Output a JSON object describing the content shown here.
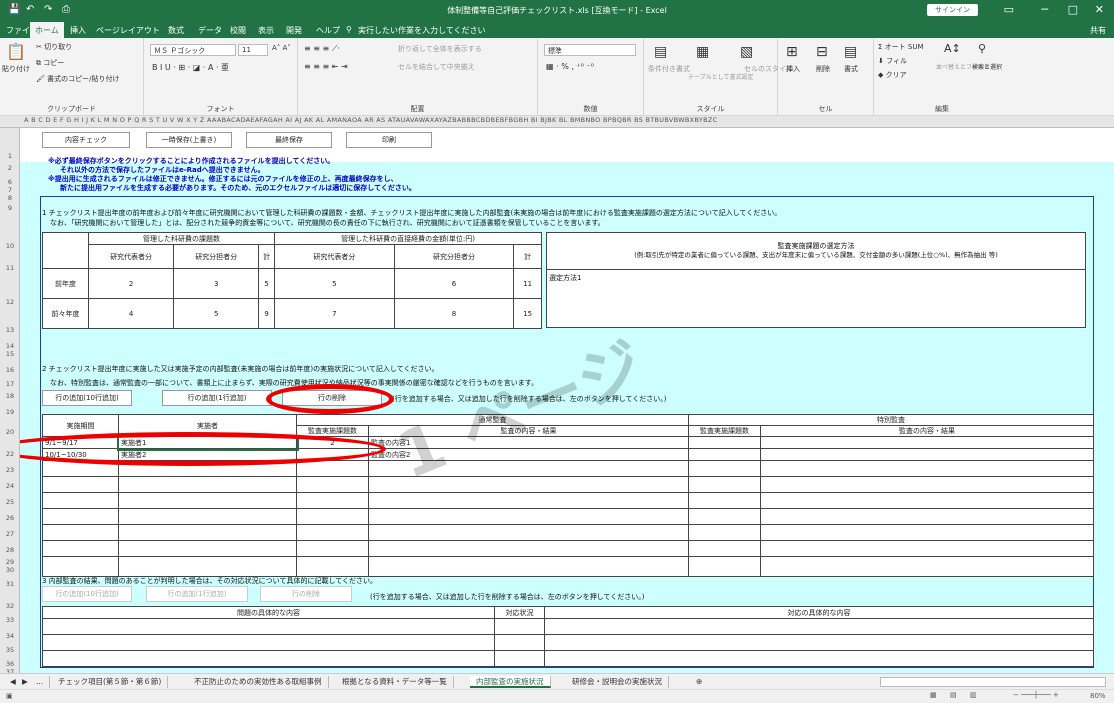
{
  "title": "体制整備等自己評価チェックリスト.xls [互換モード] - Excel",
  "signin": "サインイン",
  "ribbon_tabs": [
    "ファイル",
    "ホーム",
    "挿入",
    "ページレイアウト",
    "数式",
    "データ",
    "校閲",
    "表示",
    "開発",
    "ヘルプ"
  ],
  "tell_me": "実行したい作業を入力してください",
  "share": "共有",
  "clipboard": {
    "paste": "貼り付け",
    "cut": "切り取り",
    "copy": "コピー",
    "format_painter": "書式のコピー/貼り付け",
    "label": "クリップボード"
  },
  "font": {
    "name": "ＭＳ Ｐゴシック",
    "size": "11",
    "label": "フォント"
  },
  "align": {
    "wrap": "折り返して全体を表示する",
    "merge": "セルを結合して中央揃え",
    "label": "配置"
  },
  "number": {
    "format": "標準",
    "label": "数値"
  },
  "styles": {
    "cond": "条件付き書式",
    "table": "テーブルとして書式設定",
    "cell": "セルのスタイル",
    "label": "スタイル"
  },
  "cells": {
    "insert": "挿入",
    "delete": "削除",
    "format": "書式",
    "label": "セル"
  },
  "editing": {
    "autosum": "オート SUM",
    "fill": "フィル",
    "clear": "クリア",
    "sort": "並べ替えとフィルター",
    "find": "検索と選択",
    "label": "編集"
  },
  "col_headers": "A  B  C  D  E  F G H I J K L M N O P Q R S T U V W X Y Z AAABACADAEAFAGAH AI AJ AK AL AMANAOA AR AS ATAUAVAWAXAYAZBABBBCBDBEBFBGBH BI BJBK BL BMBNBO BPBQBR BS BTBUBVBWBXBYBZC",
  "row_numbers": [
    "1",
    "2",
    "6",
    "7",
    "8",
    "9",
    "10",
    "11",
    "12",
    "13",
    "14",
    "15",
    "16",
    "17",
    "18",
    "19",
    "20",
    "22",
    "23",
    "24",
    "25",
    "26",
    "27",
    "28",
    "29",
    "30",
    "31",
    "32",
    "33",
    "34",
    "35",
    "36",
    "37"
  ],
  "buttons": {
    "check": "内容チェック",
    "temp_save": "一時保存(上書き)",
    "final_save": "最終保存",
    "print": "印刷"
  },
  "notes": [
    "※必ず最終保存ボタンをクリックすることにより作成されるファイルを提出してください。",
    "それ以外の方法で保存したファイルはe-Radへ提出できません。",
    "※提出用に生成されるファイルは修正できません。修正するには元のファイルを修正の上、再度最終保存をし、",
    "新たに提出用ファイルを生成する必要があります。そのため、元のエクセルファイルは適切に保存してください。"
  ],
  "section1": {
    "text1": "1 チェックリスト提出年度の前年度および前々年度に研究機関において管理した科研費の課題数・金額、チェックリスト提出年度に実施した内部監査(未実施の場合は前年度)における監査実施課題の選定方法について記入してください。",
    "text2": "なお、「研究機関において管理した」とは、配分された競争的資金等について、研究機関の長の責任の下に執行され、研究機関において証憑書類を保管していることを言います。",
    "grp1": "管理した科研費の課題数",
    "grp2": "管理した科研費の直接経費の金額(単位:円)",
    "sub": [
      "研究代表者分",
      "研究分担者分",
      "計",
      "研究代表者分",
      "研究分担者分",
      "計"
    ],
    "rows": [
      {
        "label": "前年度",
        "vals": [
          "2",
          "3",
          "5",
          "5",
          "6",
          "11"
        ]
      },
      {
        "label": "前々年度",
        "vals": [
          "4",
          "5",
          "9",
          "7",
          "8",
          "15"
        ]
      }
    ],
    "method_title": "監査実施課題の選定方法",
    "method_example": "(例:取引先が特定の業者に偏っている課題、支出が年度末に偏っている課題、交付金額の多い課題(上位○%)、無作為抽出 等)",
    "method_value": "選定方法1"
  },
  "section2": {
    "text1": "2 チェックリスト提出年度に実施した又は実施予定の内部監査(未実施の場合は前年度)の実施状況について記入してください。",
    "text2": "なお、特別監査は、通常監査の一部について、書類上に止まらず、実際の研究費使用状況や納品状況等の事実関係の厳密な確認などを行うものを言います。",
    "btn_add10": "行の追加(10行追加)",
    "btn_add1": "行の追加(1行追加)",
    "btn_delete": "行の削除",
    "hint": "(行を追加する場合、又は追加した行を削除する場合は、左のボタンを押してください。)",
    "normal": "通常監査",
    "special": "特別監査",
    "headers": [
      "実施期間",
      "実施者",
      "監査実施課題数",
      "監査の内容・結果",
      "監査実施課題数",
      "監査の内容・結果"
    ],
    "rows": [
      {
        "period": "9/1~9/17",
        "who": "実施者1",
        "count": "2",
        "content": "監査の内容1"
      },
      {
        "period": "10/1~10/30",
        "who": "実施者2",
        "count": "",
        "content": "監査の内容2"
      }
    ]
  },
  "section3": {
    "text": "3 内部監査の結果、問題のあることが判明した場合は、その対応状況について具体的に記載してください。",
    "btn_add10": "行の追加(10行追加)",
    "btn_add1": "行の追加(1行追加)",
    "btn_delete": "行の削除",
    "hint": "(行を追加する場合、又は追加した行を削除する場合は、左のボタンを押してください。)",
    "headers": [
      "問題の具体的な内容",
      "対応状況",
      "対応の具体的な内容"
    ]
  },
  "watermark": "1 ページ",
  "sheet_tabs": [
    "...",
    "チェック項目(第５節・第６節)",
    "不正防止のための実効性ある取組事例",
    "根拠となる資料・データ等一覧",
    "内部監査の実施状況",
    "研修会・説明会の実施状況"
  ],
  "zoom": "80%"
}
